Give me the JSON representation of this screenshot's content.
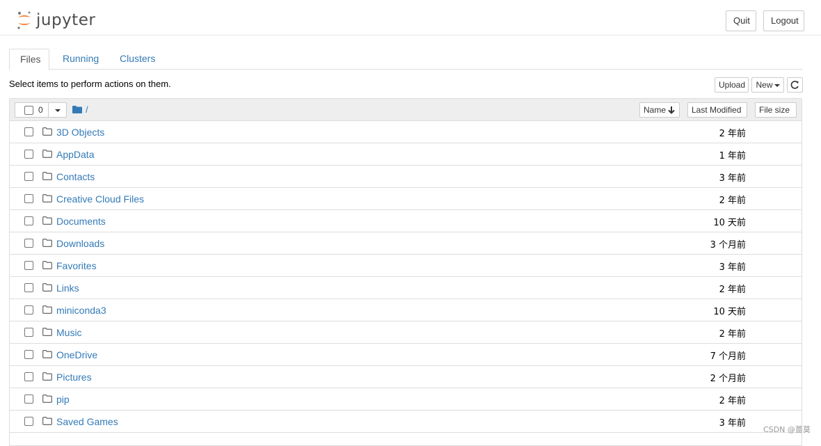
{
  "header": {
    "logo_text": "jupyter",
    "quit_label": "Quit",
    "logout_label": "Logout"
  },
  "tabs": [
    {
      "label": "Files",
      "active": true
    },
    {
      "label": "Running",
      "active": false
    },
    {
      "label": "Clusters",
      "active": false
    }
  ],
  "toolbar": {
    "info": "Select items to perform actions on them.",
    "upload_label": "Upload",
    "new_label": "New",
    "refresh_icon": "refresh-icon"
  },
  "list_header": {
    "selected_count": "0",
    "path": "/",
    "sort_name_label": "Name",
    "sort_modified_label": "Last Modified",
    "sort_size_label": "File size"
  },
  "items": [
    {
      "name": "3D Objects",
      "modified": "2 年前"
    },
    {
      "name": "AppData",
      "modified": "1 年前"
    },
    {
      "name": "Contacts",
      "modified": "3 年前"
    },
    {
      "name": "Creative Cloud Files",
      "modified": "2 年前"
    },
    {
      "name": "Documents",
      "modified": "10 天前"
    },
    {
      "name": "Downloads",
      "modified": "3 个月前"
    },
    {
      "name": "Favorites",
      "modified": "3 年前"
    },
    {
      "name": "Links",
      "modified": "2 年前"
    },
    {
      "name": "miniconda3",
      "modified": "10 天前"
    },
    {
      "name": "Music",
      "modified": "2 年前"
    },
    {
      "name": "OneDrive",
      "modified": "7 个月前"
    },
    {
      "name": "Pictures",
      "modified": "2 个月前"
    },
    {
      "name": "pip",
      "modified": "2 年前"
    },
    {
      "name": "Saved Games",
      "modified": "3 年前"
    }
  ],
  "watermark": "CSDN @蔷莫",
  "colors": {
    "link": "#337ab7",
    "logo_orange": "#f37726",
    "header_bg": "#eeeeee",
    "border": "#dddddd"
  }
}
